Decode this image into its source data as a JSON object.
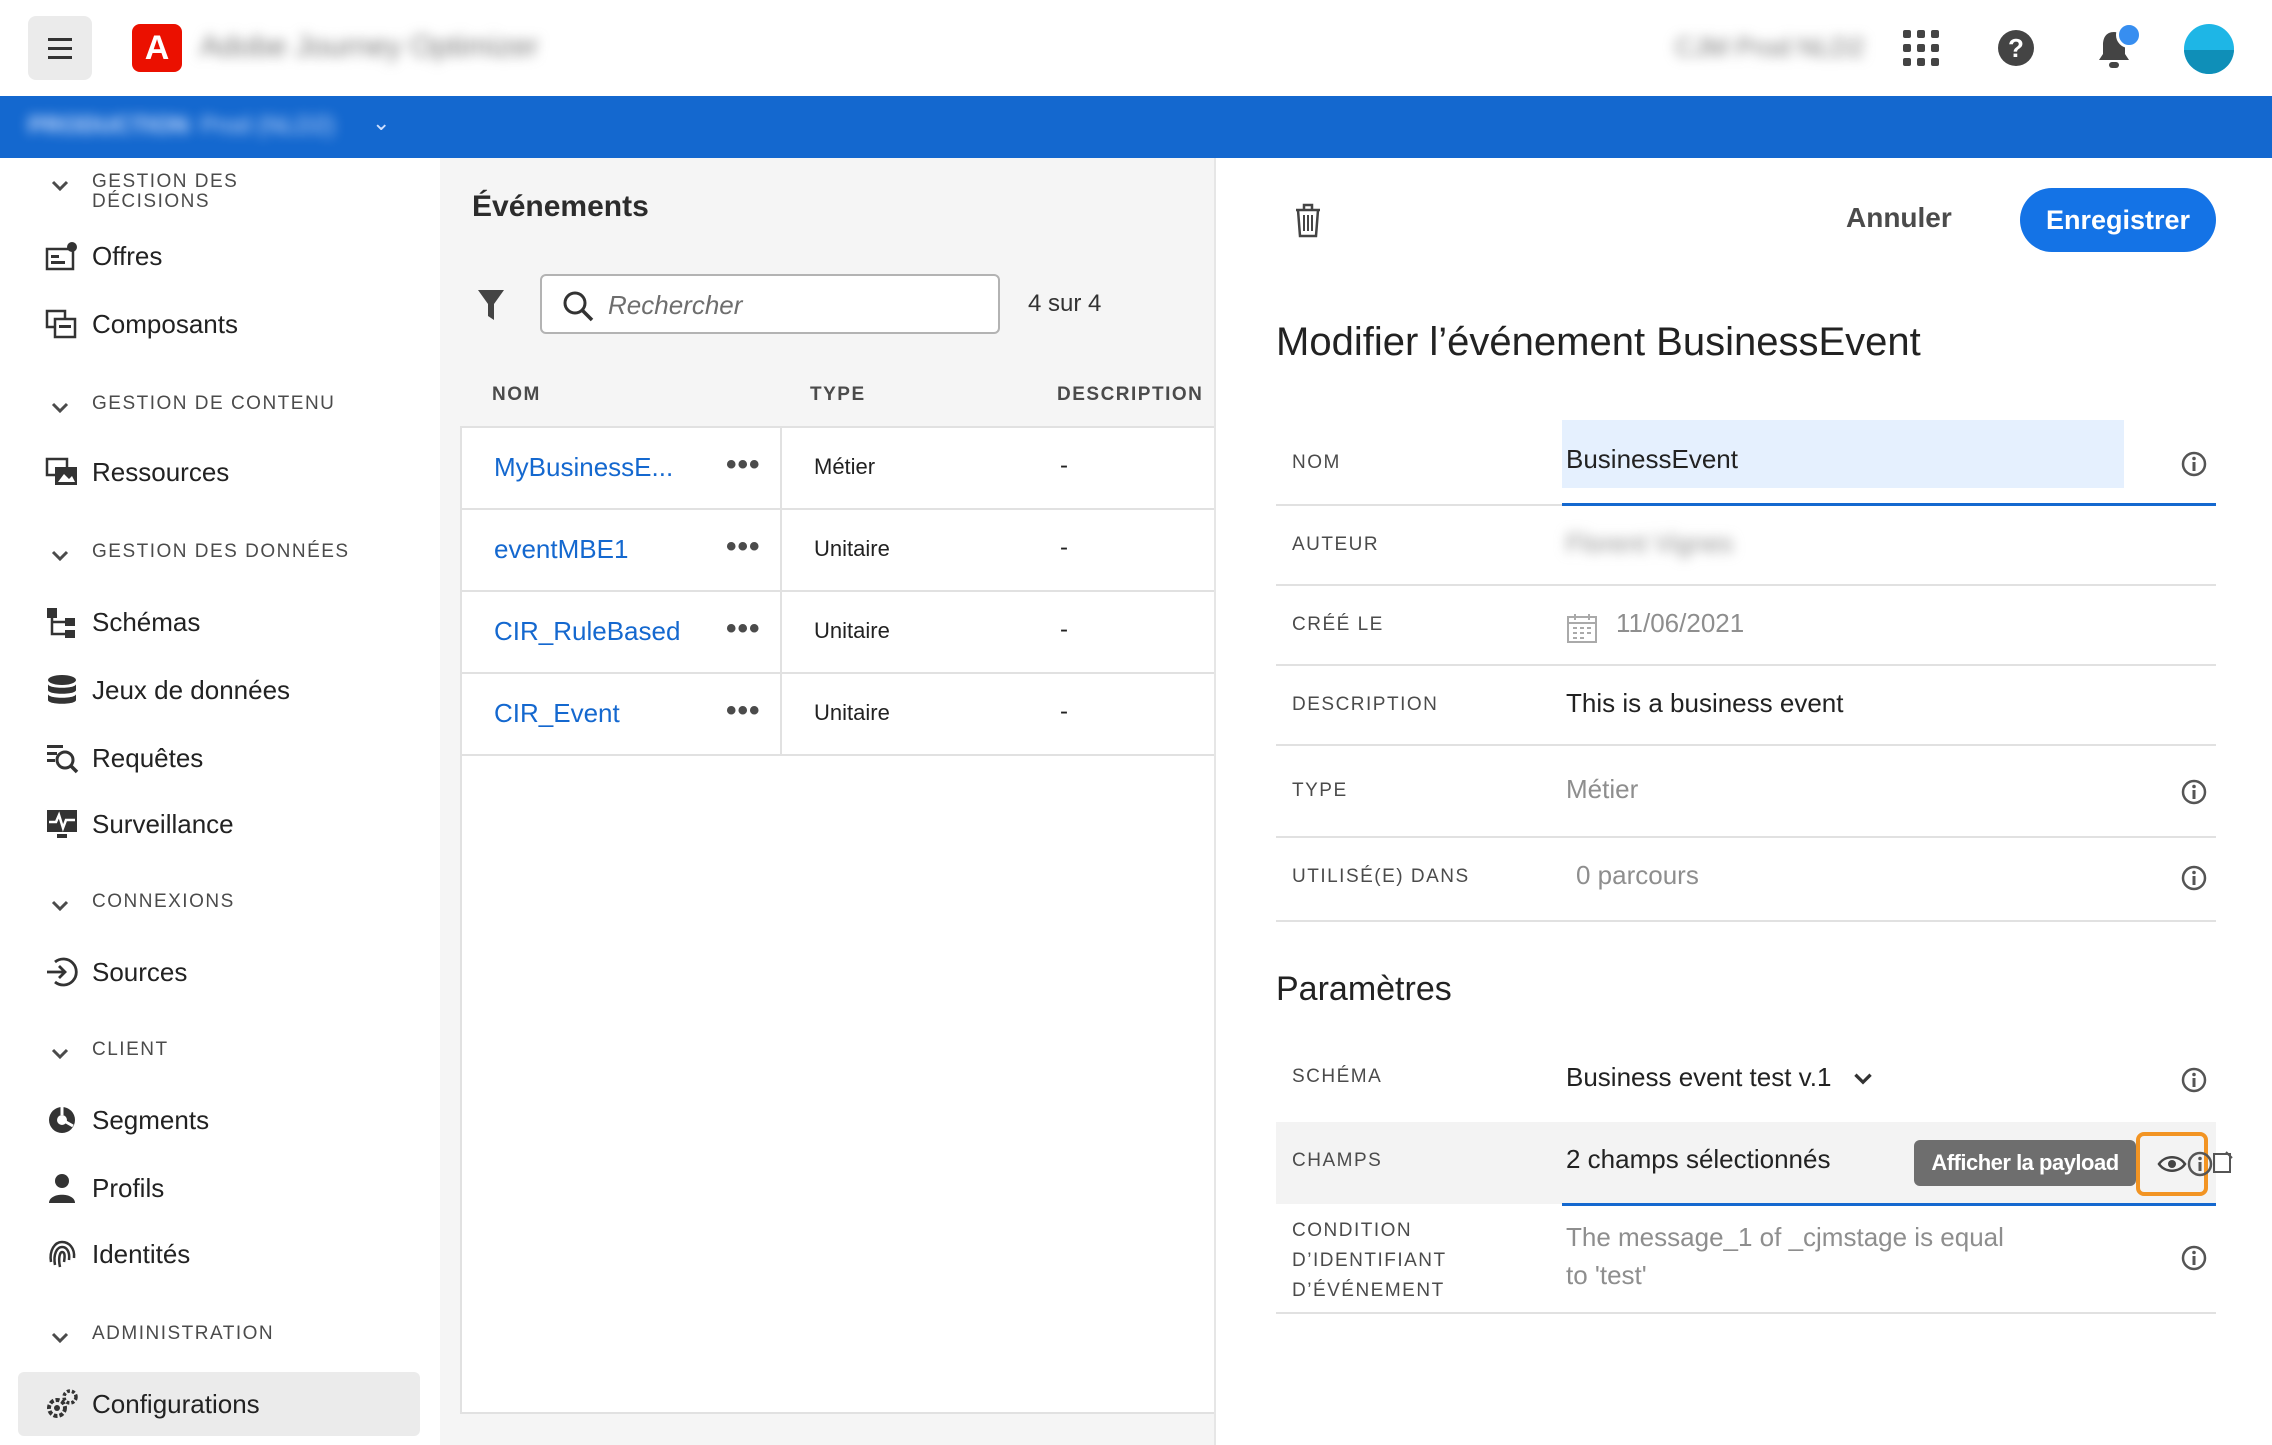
{
  "topbar": {
    "app_title": "Adobe Journey Optimizer",
    "org_name": "CJM Prod NLD2",
    "icons": [
      "menu-icon",
      "adobe-logo",
      "apps-grid-icon",
      "help-icon",
      "bell-icon",
      "avatar"
    ]
  },
  "sandbox": {
    "env": "PRODUCTION",
    "name": "Prod (NLD2)"
  },
  "nav": {
    "sections": [
      {
        "label": "GESTION DES\nDÉCISIONS",
        "items": [
          {
            "label": "Offres",
            "icon": "offers-icon"
          },
          {
            "label": "Composants",
            "icon": "components-icon"
          }
        ]
      },
      {
        "label": "GESTION DE CONTENU",
        "items": [
          {
            "label": "Ressources",
            "icon": "assets-icon"
          }
        ]
      },
      {
        "label": "GESTION DES DONNÉES",
        "items": [
          {
            "label": "Schémas",
            "icon": "schema-icon"
          },
          {
            "label": "Jeux de données",
            "icon": "datasets-icon"
          },
          {
            "label": "Requêtes",
            "icon": "queries-icon"
          },
          {
            "label": "Surveillance",
            "icon": "monitoring-icon"
          }
        ]
      },
      {
        "label": "CONNEXIONS",
        "items": [
          {
            "label": "Sources",
            "icon": "sources-icon"
          }
        ]
      },
      {
        "label": "CLIENT",
        "items": [
          {
            "label": "Segments",
            "icon": "segments-icon"
          },
          {
            "label": "Profils",
            "icon": "profiles-icon"
          },
          {
            "label": "Identités",
            "icon": "identities-icon"
          }
        ]
      },
      {
        "label": "ADMINISTRATION",
        "items": [
          {
            "label": "Configurations",
            "icon": "configurations-icon",
            "active": true
          }
        ]
      }
    ]
  },
  "events_list": {
    "title": "Événements",
    "search_placeholder": "Rechercher",
    "count": "4 sur 4",
    "columns": [
      "NOM",
      "TYPE",
      "DESCRIPTION"
    ],
    "rows": [
      {
        "name": "MyBusinessE...",
        "type": "Métier",
        "description": "-"
      },
      {
        "name": "eventMBE1",
        "type": "Unitaire",
        "description": "-"
      },
      {
        "name": "CIR_RuleBased",
        "type": "Unitaire",
        "description": "-"
      },
      {
        "name": "CIR_Event",
        "type": "Unitaire",
        "description": "-"
      }
    ]
  },
  "detail": {
    "cancel_label": "Annuler",
    "save_label": "Enregistrer",
    "title": "Modifier l’événement BusinessEvent",
    "fields": {
      "nom": {
        "label": "NOM",
        "value": "BusinessEvent"
      },
      "auteur": {
        "label": "AUTEUR",
        "value": "Florent Vignes"
      },
      "cree_le": {
        "label": "CRÉÉ LE",
        "value": "11/06/2021"
      },
      "description": {
        "label": "DESCRIPTION",
        "value": "This is a business event"
      },
      "type": {
        "label": "TYPE",
        "value": "Métier"
      },
      "utilise_dans": {
        "label": "UTILISÉ(E) DANS",
        "value": "0 parcours"
      }
    },
    "parameters_title": "Paramètres",
    "params": {
      "schema": {
        "label": "SCHÉMA",
        "value": "Business event test v.1"
      },
      "champs": {
        "label": "CHAMPS",
        "value": "2 champs sélectionnés",
        "tooltip": "Afficher la payload"
      },
      "condition": {
        "label_line1": "CONDITION",
        "label_line2": "D’IDENTIFIANT",
        "label_line3": "D’ÉVÉNEMENT",
        "value_line1": "The message_1 of _cjmstage is equal",
        "value_line2": "to 'test'"
      }
    },
    "highlight_color": "#f29423",
    "accent_color": "#1473e6"
  }
}
